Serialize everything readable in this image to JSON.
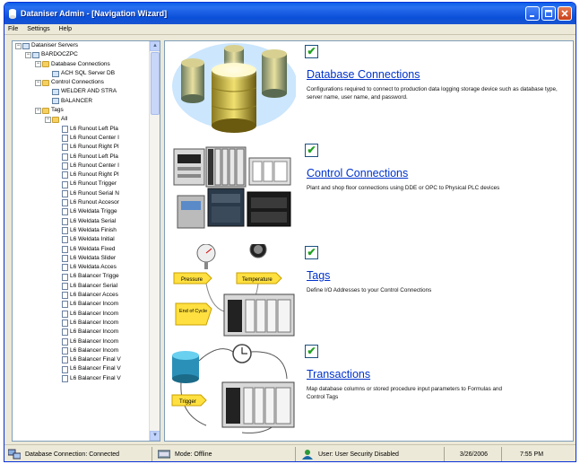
{
  "window": {
    "title": "Dataniser Admin - [Navigation Wizard]"
  },
  "menu": [
    "File",
    "Settings",
    "Help"
  ],
  "tree": [
    {
      "label": "Dataniser Servers",
      "level": 0,
      "exp": "−",
      "icon": "server-icon"
    },
    {
      "label": "BARDOCZPC",
      "level": 1,
      "exp": "−",
      "icon": "computer-icon"
    },
    {
      "label": "Database Connections",
      "level": 2,
      "exp": "−",
      "icon": "folder-icon"
    },
    {
      "label": "ACH SQL Server DB",
      "level": 3,
      "exp": "",
      "icon": "database-icon"
    },
    {
      "label": "Control Connections",
      "level": 2,
      "exp": "−",
      "icon": "folder-icon"
    },
    {
      "label": "WELDER AND STRA",
      "level": 3,
      "exp": "",
      "icon": "plc-icon"
    },
    {
      "label": "BALANCER",
      "level": 3,
      "exp": "",
      "icon": "plc-icon"
    },
    {
      "label": "Tags",
      "level": 2,
      "exp": "−",
      "icon": "folder-icon"
    },
    {
      "label": "All",
      "level": 3,
      "exp": "−",
      "icon": "folder-icon"
    },
    {
      "label": "L6 Runout Left Pla",
      "level": 4,
      "exp": "",
      "icon": "tag-icon"
    },
    {
      "label": "L6 Runout Center I",
      "level": 4,
      "exp": "",
      "icon": "tag-icon"
    },
    {
      "label": "L6 Runout Right Pl",
      "level": 4,
      "exp": "",
      "icon": "tag-icon"
    },
    {
      "label": "L6 Runout Left Pla",
      "level": 4,
      "exp": "",
      "icon": "tag-icon"
    },
    {
      "label": "L6 Runout Center I",
      "level": 4,
      "exp": "",
      "icon": "tag-icon"
    },
    {
      "label": "L6 Runout Right Pl",
      "level": 4,
      "exp": "",
      "icon": "tag-icon"
    },
    {
      "label": "L6 Runout Trigger",
      "level": 4,
      "exp": "",
      "icon": "tag-icon"
    },
    {
      "label": "L6 Runout Serial N",
      "level": 4,
      "exp": "",
      "icon": "tag-icon"
    },
    {
      "label": "L6 Runout Accesor",
      "level": 4,
      "exp": "",
      "icon": "tag-icon"
    },
    {
      "label": "L6 Weldata Trigge",
      "level": 4,
      "exp": "",
      "icon": "tag-icon"
    },
    {
      "label": "L6 Weldata Serial",
      "level": 4,
      "exp": "",
      "icon": "tag-icon"
    },
    {
      "label": "L6 Weldata Finish",
      "level": 4,
      "exp": "",
      "icon": "tag-icon"
    },
    {
      "label": "L6 Weldata Initial",
      "level": 4,
      "exp": "",
      "icon": "tag-icon"
    },
    {
      "label": "L6 Weldata Fixed",
      "level": 4,
      "exp": "",
      "icon": "tag-icon"
    },
    {
      "label": "L6 Weldata Slider",
      "level": 4,
      "exp": "",
      "icon": "tag-icon"
    },
    {
      "label": "L6 Weldata Acces",
      "level": 4,
      "exp": "",
      "icon": "tag-icon"
    },
    {
      "label": "L6 Balancer Trigge",
      "level": 4,
      "exp": "",
      "icon": "tag-icon"
    },
    {
      "label": "L6 Balancer Serial",
      "level": 4,
      "exp": "",
      "icon": "tag-icon"
    },
    {
      "label": "L6 Balancer Acces",
      "level": 4,
      "exp": "",
      "icon": "tag-icon"
    },
    {
      "label": "L6 Balancer Incom",
      "level": 4,
      "exp": "",
      "icon": "tag-icon"
    },
    {
      "label": "L6 Balancer Incom",
      "level": 4,
      "exp": "",
      "icon": "tag-icon"
    },
    {
      "label": "L6 Balancer Incom",
      "level": 4,
      "exp": "",
      "icon": "tag-icon"
    },
    {
      "label": "L6 Balancer Incom",
      "level": 4,
      "exp": "",
      "icon": "tag-icon"
    },
    {
      "label": "L6 Balancer Incom",
      "level": 4,
      "exp": "",
      "icon": "tag-icon"
    },
    {
      "label": "L6 Balancer Incom",
      "level": 4,
      "exp": "",
      "icon": "tag-icon"
    },
    {
      "label": "L6 Balancer Final V",
      "level": 4,
      "exp": "",
      "icon": "tag-icon"
    },
    {
      "label": "L6 Balancer Final V",
      "level": 4,
      "exp": "",
      "icon": "tag-icon"
    },
    {
      "label": "L6 Balancer Final V",
      "level": 4,
      "exp": "",
      "icon": "tag-icon"
    }
  ],
  "sections": [
    {
      "id": "database-connections",
      "title": "Database Connections",
      "checked": true,
      "description": "Configurations required to connect to production data logging storage device such as database type, server name, user name, and password."
    },
    {
      "id": "control-connections",
      "title": "Control Connections",
      "checked": true,
      "description": "Plant and shop floor connections using DDE or OPC to Physical PLC devices"
    },
    {
      "id": "tags",
      "title": "Tags",
      "checked": true,
      "description": "Define I/O Addresses to your Control Connections"
    },
    {
      "id": "transactions",
      "title": "Transactions",
      "checked": true,
      "description": "Map database columns or stored procedure input parameters to Formulas and Control Tags"
    }
  ],
  "illustration_labels": {
    "pressure": "Pressure",
    "temperature": "Temperature",
    "end_of_cycle": "End of Cycle",
    "trigger": "Trigger"
  },
  "status": {
    "db": "Database Connection: Connected",
    "mode": "Mode: Offline",
    "user": "User: User Security Disabled",
    "date": "3/26/2006",
    "time": "7:55 PM"
  }
}
